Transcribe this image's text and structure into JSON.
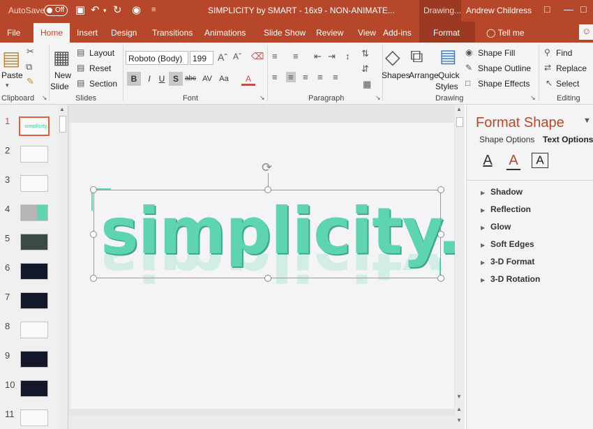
{
  "titlebar": {
    "autosave_label": "AutoSave",
    "autosave_state": "Off",
    "doc_title": "SIMPLICITY by SMART - 16x9 - NON-ANIMATE...",
    "context_label": "Drawing...",
    "user_name": "Andrew Childress"
  },
  "tabs": [
    "File",
    "Home",
    "Insert",
    "Design",
    "Transitions",
    "Animations",
    "Slide Show",
    "Review",
    "View",
    "Add-ins",
    "Format"
  ],
  "tell_me": "Tell me",
  "ribbon": {
    "clipboard": {
      "paste": "Paste",
      "label": "Clipboard"
    },
    "slides": {
      "new_slide_1": "New",
      "new_slide_2": "Slide",
      "layout": "Layout",
      "reset": "Reset",
      "section": "Section",
      "label": "Slides"
    },
    "font": {
      "font_name": "Roboto (Body)",
      "font_size": "199",
      "label": "Font",
      "bold": "B",
      "italic": "I",
      "underline": "U",
      "shadow": "S",
      "strike": "abc",
      "spacing": "AV",
      "case": "Aa",
      "color": "A"
    },
    "paragraph": {
      "label": "Paragraph"
    },
    "drawing": {
      "shapes": "Shapes",
      "arrange": "Arrange",
      "quick_1": "Quick",
      "quick_2": "Styles",
      "fill": "Shape Fill",
      "outline": "Shape Outline",
      "effects": "Shape Effects",
      "label": "Drawing"
    },
    "editing": {
      "find": "Find",
      "replace": "Replace",
      "select": "Select",
      "label": "Editing"
    }
  },
  "thumbnails": [
    "1",
    "2",
    "3",
    "4",
    "5",
    "6",
    "7",
    "8",
    "9",
    "10",
    "11"
  ],
  "thumb1_text": "simplicity.",
  "slide": {
    "word": "simplicity."
  },
  "format_pane": {
    "title": "Format Shape",
    "tab_shape": "Shape Options",
    "tab_text": "Text Options",
    "sections": [
      "Shadow",
      "Reflection",
      "Glow",
      "Soft Edges",
      "3-D Format",
      "3-D Rotation"
    ]
  },
  "colors": {
    "accent": "#b7472a",
    "teal": "#5fd4b2"
  }
}
